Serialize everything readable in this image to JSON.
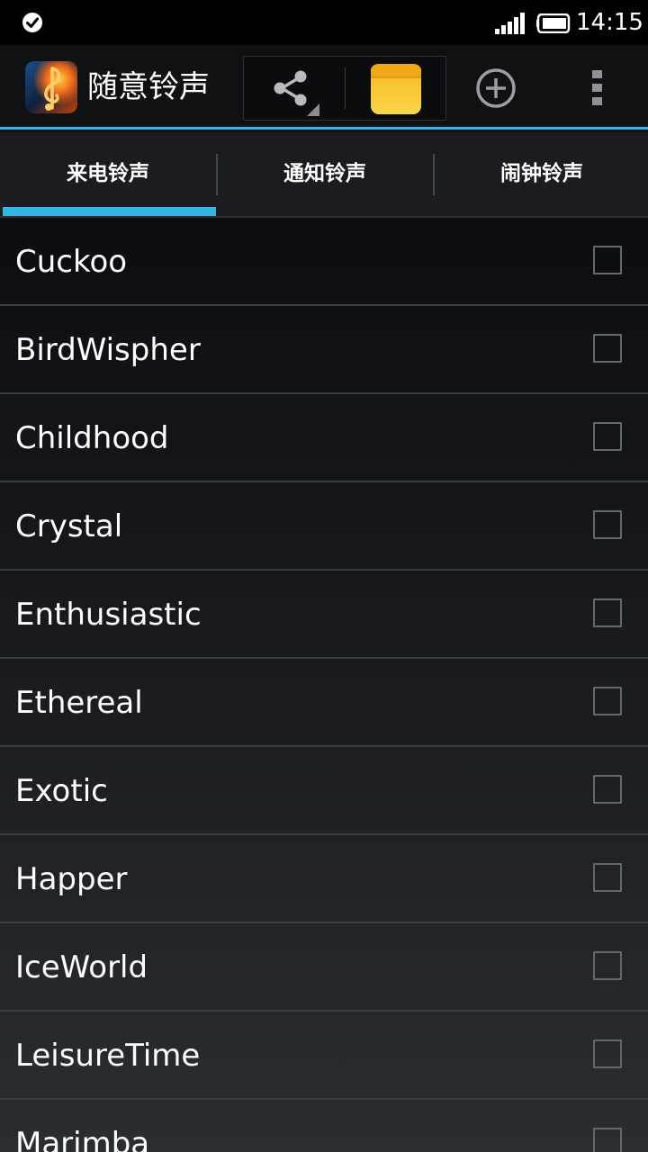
{
  "status_bar": {
    "time": "14:15",
    "left_icon": "check-circle-icon",
    "signal_icon": "signal-icon",
    "battery_icon": "battery-icon"
  },
  "action_bar": {
    "app_icon": "music-note-flame-icon",
    "title": "随意铃声",
    "actions": {
      "share_icon": "share-icon",
      "notes_icon": "notes-icon",
      "add_icon": "add-circle-icon",
      "overflow_icon": "overflow-menu-icon"
    }
  },
  "tabs": [
    {
      "label": "来电铃声",
      "selected": true
    },
    {
      "label": "通知铃声",
      "selected": false
    },
    {
      "label": "闹钟铃声",
      "selected": false
    }
  ],
  "ringtones": [
    {
      "name": "Cuckoo",
      "checked": false
    },
    {
      "name": "BirdWispher",
      "checked": false
    },
    {
      "name": "Childhood",
      "checked": false
    },
    {
      "name": "Crystal",
      "checked": false
    },
    {
      "name": "Enthusiastic",
      "checked": false
    },
    {
      "name": "Ethereal",
      "checked": false
    },
    {
      "name": "Exotic",
      "checked": false
    },
    {
      "name": "Happer",
      "checked": false
    },
    {
      "name": "IceWorld",
      "checked": false
    },
    {
      "name": "LeisureTime",
      "checked": false
    },
    {
      "name": "Marimba",
      "checked": false
    }
  ],
  "colors": {
    "accent": "#33b5e5",
    "background": "#111214",
    "notes_yellow": "#f7c42c"
  }
}
